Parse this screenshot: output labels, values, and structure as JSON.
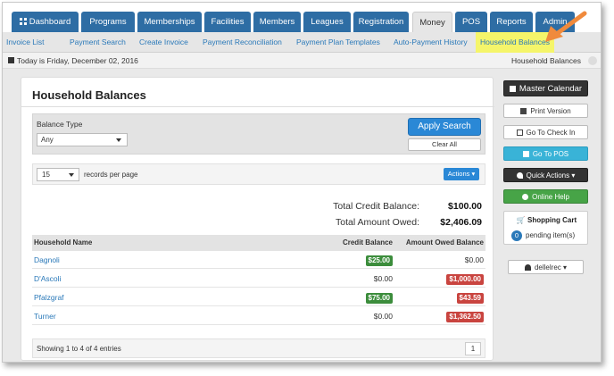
{
  "top_nav": {
    "tabs": [
      {
        "label": "Dashboard"
      },
      {
        "label": "Programs"
      },
      {
        "label": "Memberships"
      },
      {
        "label": "Facilities"
      },
      {
        "label": "Members"
      },
      {
        "label": "Leagues"
      },
      {
        "label": "Registration"
      },
      {
        "label": "Money",
        "active": true
      },
      {
        "label": "POS"
      },
      {
        "label": "Reports"
      },
      {
        "label": "Admin"
      }
    ]
  },
  "sub_nav": {
    "items": [
      {
        "label": "Invoice List"
      },
      {
        "label": "Payment Search"
      },
      {
        "label": "Create Invoice"
      },
      {
        "label": "Payment Reconciliation"
      },
      {
        "label": "Payment Plan Templates"
      },
      {
        "label": "Auto-Payment History"
      },
      {
        "label": "Household Balances",
        "active": true
      }
    ]
  },
  "date_bar": {
    "today": "Today is Friday, December 02, 2016",
    "breadcrumb": "Household Balances"
  },
  "page": {
    "title": "Household Balances",
    "filter": {
      "balance_type_label": "Balance Type",
      "balance_type_value": "Any",
      "apply_label": "Apply Search",
      "clear_label": "Clear All"
    },
    "records": {
      "per_page": "15",
      "per_page_label": "records per page",
      "actions_label": "Actions"
    },
    "totals": {
      "credit_label": "Total Credit Balance:",
      "credit_value": "$100.00",
      "owed_label": "Total Amount Owed:",
      "owed_value": "$2,406.09"
    },
    "table": {
      "headers": [
        "Household Name",
        "Credit Balance",
        "Amount Owed Balance"
      ],
      "rows": [
        {
          "name": "Dagnoli",
          "credit": "$25.00",
          "credit_style": "green",
          "owed": "$0.00",
          "owed_style": "plain"
        },
        {
          "name": "D'Ascoli",
          "credit": "$0.00",
          "credit_style": "plain",
          "owed": "$1,000.00",
          "owed_style": "red"
        },
        {
          "name": "Pfalzgraf",
          "credit": "$75.00",
          "credit_style": "green",
          "owed": "$43.59",
          "owed_style": "red"
        },
        {
          "name": "Turner",
          "credit": "$0.00",
          "credit_style": "plain",
          "owed": "$1,362.50",
          "owed_style": "red"
        }
      ]
    },
    "footer": {
      "showing": "Showing 1 to 4 of 4 entries",
      "page": "1"
    }
  },
  "sidebar": {
    "master_calendar": "Master Calendar",
    "print_version": "Print Version",
    "check_in": "Go To Check In",
    "pos": "Go To POS",
    "quick_actions": "Quick Actions",
    "online_help": "Online Help",
    "cart_title": "Shopping Cart",
    "cart_count": "0",
    "cart_text": "pending item(s)",
    "user": "dellelrec"
  },
  "colors": {
    "nav_blue": "#2e6da4",
    "link_blue": "#2a79b9",
    "highlight_yellow": "#f5f56a",
    "badge_green": "#3c8d3c",
    "badge_red": "#c9443f",
    "annotation_arrow": "#f08a3c"
  }
}
